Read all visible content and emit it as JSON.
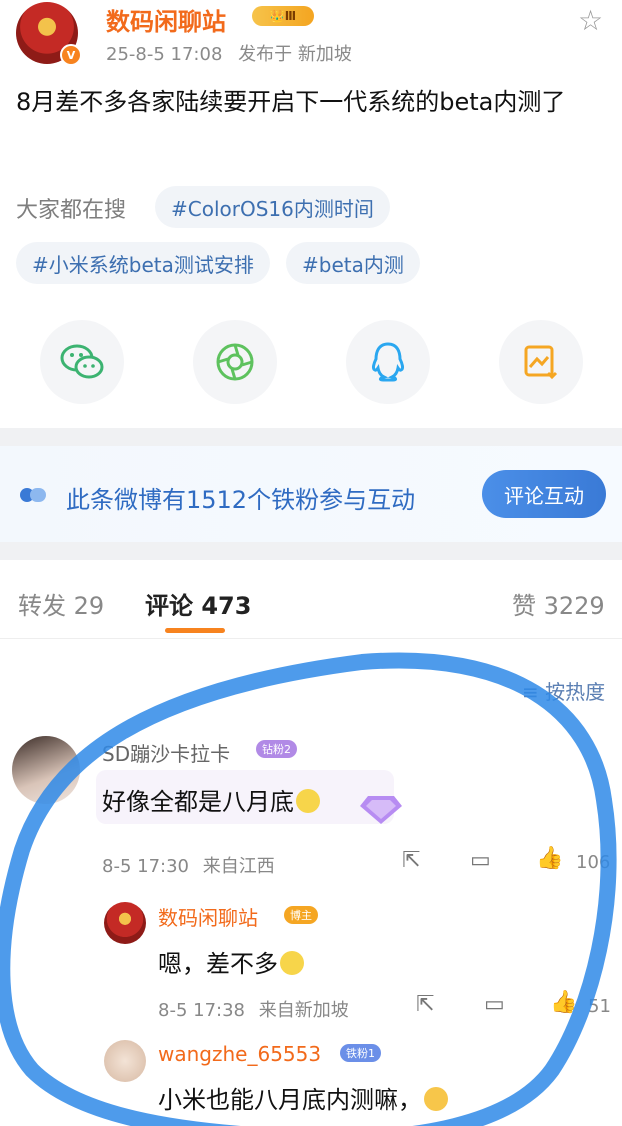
{
  "header": {
    "author": "数码闲聊站",
    "level": "Ⅲ",
    "date": "25-8-5 17:08",
    "location": "发布于 新加坡",
    "verified": "V"
  },
  "post": {
    "text": "8月差不多各家陆续要开启下一代系统的beta内测了"
  },
  "search": {
    "label": "大家都在搜",
    "tags": [
      "#ColorOS16内测时间",
      "#小米系统beta测试安排",
      "#beta内测"
    ]
  },
  "share": {
    "icons": [
      "wechat-icon",
      "moments-icon",
      "qq-icon",
      "save-image-icon"
    ]
  },
  "fans": {
    "text": "此条微博有1512个铁粉参与互动",
    "button": "评论互动"
  },
  "tabs": {
    "repost": "转发 29",
    "comment": "评论 473",
    "like": "赞 3229"
  },
  "sort": {
    "label": "按热度"
  },
  "comments": [
    {
      "name": "SD蹦沙卡拉卡",
      "badge": "钻粉2",
      "text": "好像全都是八月底",
      "time": "8-5 17:30",
      "from": "来自江西",
      "likes": "106"
    }
  ],
  "replies": [
    {
      "name": "数码闲聊站",
      "badge": "博主",
      "text": "嗯，差不多",
      "time": "8-5 17:38",
      "from": "来自新加坡",
      "likes": "51"
    },
    {
      "name": "wangzhe_65553",
      "badge": "铁粉1",
      "text": "小米也能八月底内测嘛，"
    }
  ],
  "colors": {
    "accent": "#f26a1b",
    "link": "#3d6fb0",
    "circle": "#2f8ae8"
  }
}
